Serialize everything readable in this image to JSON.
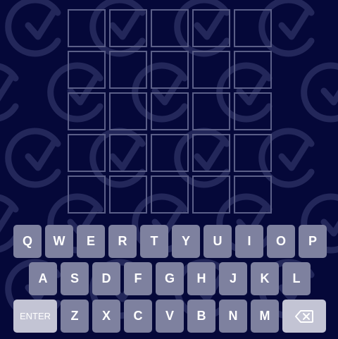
{
  "board": {
    "rows": [
      [
        "",
        "",
        "",
        "",
        ""
      ],
      [
        "",
        "",
        "",
        "",
        ""
      ],
      [
        "",
        "",
        "",
        "",
        ""
      ],
      [
        "",
        "",
        "",
        "",
        ""
      ],
      [
        "",
        "",
        "",
        "",
        ""
      ]
    ]
  },
  "keyboard": {
    "row1": [
      "Q",
      "W",
      "E",
      "R",
      "T",
      "Y",
      "U",
      "I",
      "O",
      "P"
    ],
    "row2": [
      "A",
      "S",
      "D",
      "F",
      "G",
      "H",
      "J",
      "K",
      "L"
    ],
    "row3": [
      "Z",
      "X",
      "C",
      "V",
      "B",
      "N",
      "M"
    ],
    "enter_label": "ENTER",
    "backspace_icon": "backspace-icon"
  },
  "background": {
    "logo_icon": "c-logo-icon"
  },
  "colors": {
    "background": "#050839",
    "tile_border": "#5b5f88",
    "key": "#7e819f",
    "action_key": "#c3c4d4",
    "watermark": "#2a2d5a"
  }
}
